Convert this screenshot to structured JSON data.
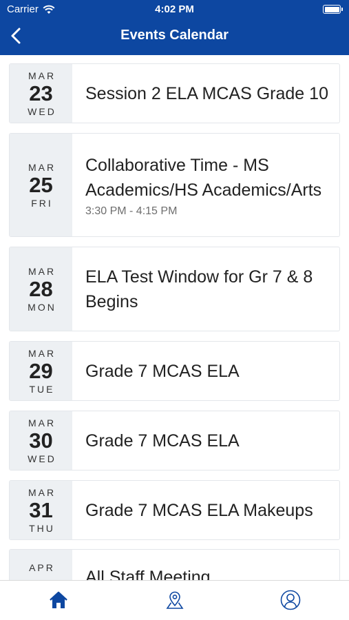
{
  "status": {
    "carrier": "Carrier",
    "time": "4:02 PM"
  },
  "header": {
    "title": "Events Calendar"
  },
  "events": [
    {
      "month": "MAR",
      "day": "23",
      "weekday": "WED",
      "title": "Session 2 ELA MCAS Grade 10",
      "time": ""
    },
    {
      "month": "MAR",
      "day": "25",
      "weekday": "FRI",
      "title": "Collaborative Time - MS Academics/HS Academics/Arts",
      "time": "3:30 PM - 4:15 PM"
    },
    {
      "month": "MAR",
      "day": "28",
      "weekday": "MON",
      "title": "ELA Test Window for Gr 7 & 8 Begins",
      "time": ""
    },
    {
      "month": "MAR",
      "day": "29",
      "weekday": "TUE",
      "title": "Grade 7 MCAS ELA",
      "time": ""
    },
    {
      "month": "MAR",
      "day": "30",
      "weekday": "WED",
      "title": "Grade 7 MCAS ELA",
      "time": ""
    },
    {
      "month": "MAR",
      "day": "31",
      "weekday": "THU",
      "title": "Grade 7 MCAS ELA Makeups",
      "time": ""
    },
    {
      "month": "APR",
      "day": "",
      "weekday": "",
      "title": "All Staff Meeting",
      "time": ""
    }
  ],
  "tabs": [
    {
      "icon": "home-icon",
      "active": true
    },
    {
      "icon": "map-pin-icon",
      "active": false
    },
    {
      "icon": "profile-icon",
      "active": false
    }
  ],
  "colors": {
    "brand": "#0d47a1",
    "date_bg": "#edf0f3"
  }
}
